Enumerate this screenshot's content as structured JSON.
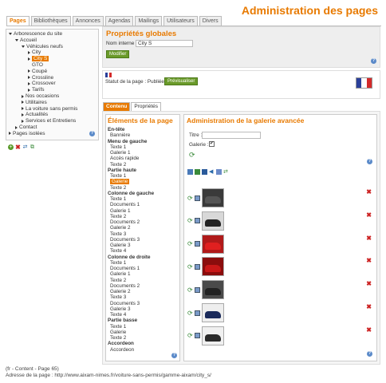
{
  "header": {
    "title": "Administration des pages"
  },
  "tabs": [
    "Pages",
    "Bibliothèques",
    "Annonces",
    "Agendas",
    "Mailings",
    "Utilisateurs",
    "Divers"
  ],
  "tree": {
    "items": [
      {
        "label": "Arborescence du site",
        "level": 0,
        "arrow": "down"
      },
      {
        "label": "Accueil",
        "level": 1,
        "arrow": "down"
      },
      {
        "label": "Véhicules neufs",
        "level": 2,
        "arrow": "down"
      },
      {
        "label": "City",
        "level": 3,
        "arrow": "right"
      },
      {
        "label": "City S",
        "level": 3,
        "arrow": "right",
        "selected": true
      },
      {
        "label": "GTO",
        "level": 3,
        "arrow": "none"
      },
      {
        "label": "Coupé",
        "level": 3,
        "arrow": "right"
      },
      {
        "label": "Crossline",
        "level": 3,
        "arrow": "right"
      },
      {
        "label": "Crossover",
        "level": 3,
        "arrow": "right"
      },
      {
        "label": "Tarifs",
        "level": 3,
        "arrow": "right"
      },
      {
        "label": "Nos occasions",
        "level": 2,
        "arrow": "right"
      },
      {
        "label": "Utilitaires",
        "level": 2,
        "arrow": "right"
      },
      {
        "label": "La voiture sans permis",
        "level": 2,
        "arrow": "right"
      },
      {
        "label": "Actualités",
        "level": 2,
        "arrow": "right"
      },
      {
        "label": "Services et Entretiens",
        "level": 2,
        "arrow": "right"
      },
      {
        "label": "Contact",
        "level": 1,
        "arrow": "right"
      },
      {
        "label": "Pages isolées",
        "level": 0,
        "arrow": "right"
      }
    ]
  },
  "props": {
    "title": "Propriétés globales",
    "name_label": "Nom interne :",
    "name_value": "City S",
    "modify_button": "Modifier"
  },
  "status": {
    "label": "Statut de la page : Publiée",
    "preview_button": "Prévisualiser"
  },
  "subtabs": [
    "Contenu",
    "Propriétés"
  ],
  "elements": {
    "title": "Éléments de la page",
    "items": [
      {
        "label": "En-tête",
        "bold": true
      },
      {
        "label": "Bannière",
        "bold": false
      },
      {
        "label": "Menu de gauche",
        "bold": true
      },
      {
        "label": "Texte 1",
        "bold": false
      },
      {
        "label": "Galerie 1",
        "bold": false
      },
      {
        "label": "Accès rapide",
        "bold": false
      },
      {
        "label": "Texte 2",
        "bold": false
      },
      {
        "label": "Partie haute",
        "bold": true
      },
      {
        "label": "Texte 1",
        "bold": false
      },
      {
        "label": "Galerie",
        "bold": false,
        "selected": true
      },
      {
        "label": "Texte 2",
        "bold": false
      },
      {
        "label": "Colonne de gauche",
        "bold": true
      },
      {
        "label": "Texte 1",
        "bold": false
      },
      {
        "label": "Documents 1",
        "bold": false
      },
      {
        "label": "Galerie 1",
        "bold": false
      },
      {
        "label": "Texte 2",
        "bold": false
      },
      {
        "label": "Documents 2",
        "bold": false
      },
      {
        "label": "Galerie 2",
        "bold": false
      },
      {
        "label": "Texte 3",
        "bold": false
      },
      {
        "label": "Documents 3",
        "bold": false
      },
      {
        "label": "Galerie 3",
        "bold": false
      },
      {
        "label": "Texte 4",
        "bold": false
      },
      {
        "label": "Colonne de droite",
        "bold": true
      },
      {
        "label": "Texte 1",
        "bold": false
      },
      {
        "label": "Documents 1",
        "bold": false
      },
      {
        "label": "Galerie 1",
        "bold": false
      },
      {
        "label": "Texte 2",
        "bold": false
      },
      {
        "label": "Documents 2",
        "bold": false
      },
      {
        "label": "Galerie 2",
        "bold": false
      },
      {
        "label": "Texte 3",
        "bold": false
      },
      {
        "label": "Documents 3",
        "bold": false
      },
      {
        "label": "Galerie 3",
        "bold": false
      },
      {
        "label": "Texte 4",
        "bold": false
      },
      {
        "label": "Partie basse",
        "bold": true
      },
      {
        "label": "Texte 1",
        "bold": false
      },
      {
        "label": "Galerie",
        "bold": false
      },
      {
        "label": "Texte 2",
        "bold": false
      },
      {
        "label": "Accordeon",
        "bold": true
      },
      {
        "label": "Accordeon",
        "bold": false
      }
    ]
  },
  "gallery": {
    "title": "Administration de la galerie avancée",
    "titre_label": "Titre :",
    "galerie_label": "Galerie :",
    "checked": true,
    "images": [
      {
        "color": "#3a3a3a",
        "car": "#555"
      },
      {
        "color": "#d8d8d8",
        "car": "#222"
      },
      {
        "color": "#b01a1a",
        "car": "#e02020"
      },
      {
        "color": "#8a0d0d",
        "car": "#c81818"
      },
      {
        "color": "#4a4a4a",
        "car": "#222"
      },
      {
        "color": "#eeeeee",
        "car": "#1a2a5a"
      },
      {
        "color": "#f0f0f0",
        "car": "#2a2a2a"
      }
    ]
  },
  "footer": {
    "line1": "(fr - Content - Page 65)",
    "line2": "Adresse de la page : http://www.aixam-nimes.fr/voiture-sans-permis/gamme-aixam/city_s/"
  },
  "colors": {
    "accent": "#e87a00",
    "green": "#6a9a2a",
    "delete": "#cc2222"
  }
}
